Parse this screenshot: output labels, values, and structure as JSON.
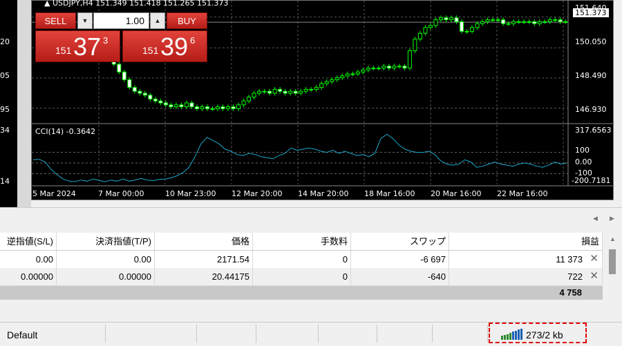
{
  "left_chart": {
    "labels": [
      "20",
      "05",
      "95",
      "34",
      "14"
    ]
  },
  "chart": {
    "title": "USDJPY,H4  151.349 151.418 151.265 151.373",
    "current_price": "151.373",
    "price_labels": [
      "151.640",
      "150.050",
      "148.490",
      "146.930"
    ],
    "indicator_title": "CCI(14) -0.3642",
    "indicator_labels": [
      "317.6563",
      "100",
      "0.00",
      "-100",
      "-200.7181"
    ],
    "time_labels": [
      "5 Mar 2024",
      "7 Mar 00:00",
      "10 Mar 23:00",
      "12 Mar 20:00",
      "14 Mar 20:00",
      "18 Mar 16:00",
      "20 Mar 16:00",
      "22 Mar 16:00"
    ]
  },
  "chart_data": {
    "type": "candlestick",
    "title": "USDJPY,H4",
    "y_ticks": [
      146.93,
      148.49,
      150.05,
      151.64
    ],
    "ylim": [
      146.2,
      152.2
    ],
    "x_tick_labels": [
      "5 Mar 2024",
      "7 Mar 00:00",
      "10 Mar 23:00",
      "12 Mar 20:00",
      "14 Mar 20:00",
      "18 Mar 16:00",
      "20 Mar 16:00",
      "22 Mar 16:00"
    ],
    "candles_close": [
      149.9,
      149.6,
      149.2,
      148.8,
      148.4,
      148.0,
      147.8,
      147.7,
      147.6,
      147.4,
      147.3,
      147.2,
      147.1,
      147.0,
      147.1,
      147.0,
      147.2,
      147.0,
      146.9,
      147.0,
      146.9,
      146.9,
      147.0,
      146.9,
      147.0,
      146.9,
      147.1,
      147.3,
      147.5,
      147.7,
      147.8,
      147.8,
      147.7,
      147.9,
      147.8,
      147.7,
      147.8,
      147.7,
      147.8,
      147.9,
      147.9,
      148.0,
      148.2,
      148.3,
      148.4,
      148.5,
      148.6,
      148.7,
      148.7,
      148.8,
      148.9,
      149.0,
      149.0,
      149.0,
      149.1,
      149.0,
      149.1,
      149.1,
      149.0,
      149.9,
      150.5,
      150.8,
      151.1,
      151.2,
      151.5,
      151.6,
      151.5,
      151.6,
      151.4,
      150.9,
      150.9,
      151.1,
      151.3,
      151.4,
      151.5,
      151.5,
      151.5,
      151.3,
      151.3,
      151.4,
      151.4,
      151.4,
      151.4,
      151.3,
      151.4,
      151.4,
      151.5,
      151.5,
      151.4,
      151.4
    ],
    "indicator": {
      "name": "CCI(14)",
      "last_value": -0.3642,
      "ylim": [
        -200.7181,
        317.6563
      ],
      "levels": [
        100,
        0,
        -100
      ],
      "values": [
        30,
        35,
        10,
        -60,
        -110,
        -150,
        -170,
        -175,
        -160,
        -170,
        -150,
        -165,
        -175,
        -160,
        -170,
        -150,
        -170,
        -160,
        -145,
        -160,
        -165,
        -155,
        -150,
        -140,
        -120,
        -90,
        -40,
        60,
        180,
        240,
        210,
        180,
        130,
        110,
        80,
        70,
        90,
        80,
        60,
        50,
        40,
        70,
        90,
        140,
        120,
        130,
        140,
        130,
        110,
        100,
        120,
        90,
        110,
        90,
        70,
        80,
        60,
        90,
        230,
        270,
        230,
        170,
        130,
        110,
        100,
        100,
        110,
        80,
        20,
        -10,
        -20,
        -10,
        30,
        10,
        -40,
        -30,
        -10,
        10,
        -10,
        -20,
        -30,
        -10,
        0,
        -10,
        -30,
        -40,
        -20,
        10,
        -10,
        0
      ]
    }
  },
  "trading_panel": {
    "sell_label": "SELL",
    "buy_label": "BUY",
    "volume": "1.00",
    "sell_price": {
      "prefix": "151",
      "main": "37",
      "sup": "3"
    },
    "buy_price": {
      "prefix": "151",
      "main": "39",
      "sup": "6"
    }
  },
  "table": {
    "headers": [
      "逆指値(S/L)",
      "決済指値(T/P)",
      "価格",
      "手数料",
      "スワップ",
      "損益"
    ],
    "rows": [
      [
        "0.00",
        "0.00",
        "2171.54",
        "0",
        "-6 697",
        "11 373"
      ],
      [
        "0.00000",
        "0.00000",
        "20.44175",
        "0",
        "-640",
        "722"
      ]
    ],
    "total": "4 758"
  },
  "status_bar": {
    "profile": "Default",
    "connection": "273/2 kb"
  }
}
